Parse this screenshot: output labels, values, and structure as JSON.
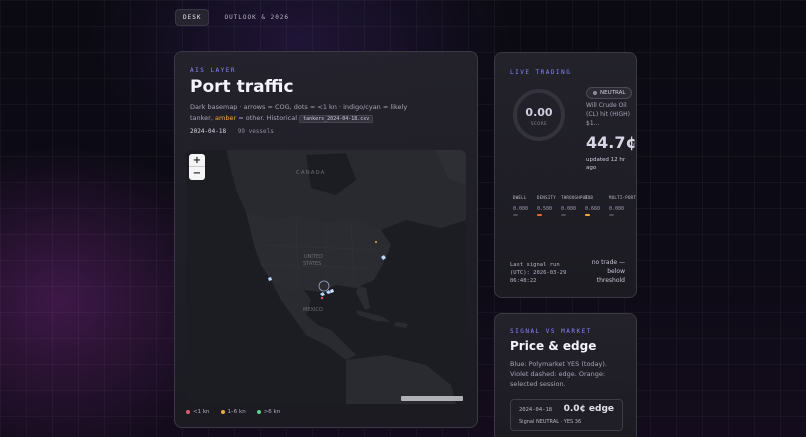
{
  "tabs": [
    {
      "label": "DESK",
      "active": true
    },
    {
      "label": "OUTLOOK & 2026",
      "active": false
    }
  ],
  "map_card": {
    "eyebrow": "AIS LAYER",
    "title": "Port traffic",
    "desc_prefix": "Dark basemap · arrows = COG, dots = <1 kn · indigo/cyan = likely tanker,",
    "desc_amber": "amber",
    "desc_suffix": "= other. Historical",
    "desc_file": "tankers_2024-04-18.csv",
    "date": "2024-04-18",
    "vessels": "99 vessels",
    "zoom_in": "+",
    "zoom_out": "−",
    "map_labels": {
      "canada": "CANADA",
      "us": "UNITED\nSTATES",
      "mexico": "MEXICO"
    },
    "legend": [
      {
        "label": "<1 kn",
        "color": "#e05a6a"
      },
      {
        "label": "1–6 kn",
        "color": "#f0a840"
      },
      {
        "label": ">6 kn",
        "color": "#5ad08a"
      }
    ]
  },
  "live_card": {
    "eyebrow": "LIVE TRADING",
    "score_value": "0.00",
    "score_label": "SCORE",
    "badge": "NEUTRAL",
    "market": "Will Crude Oil (CL) hit (HIGH) $1...",
    "price": "44.7¢",
    "price_suffix": "Y",
    "updated": "updated 12 hr ago",
    "metrics": [
      {
        "label": "DWELL",
        "value": "0.000",
        "bar_color": "#4a4954"
      },
      {
        "label": "DENSITY",
        "value": "0.500",
        "bar_color": "#e06a3a"
      },
      {
        "label": "THROUGHPUT",
        "value": "0.000",
        "bar_color": "#4a4954"
      },
      {
        "label": "BOB",
        "value": "0.660",
        "bar_color": "#f0a840"
      },
      {
        "label": "MULTI-PORT",
        "value": "0.000",
        "bar_color": "#4a4954"
      }
    ],
    "signal": "Last signal run (UTC): 2026-03-29 06:48:22",
    "no_trade": "no trade — below threshold"
  },
  "price_card": {
    "eyebrow": "SIGNAL VS MARKET",
    "title": "Price & edge",
    "desc": "Blue: Polymarket YES (today). Violet dashed: edge. Orange: selected session.",
    "date": "2024-04-18",
    "edge": "0.0¢ edge",
    "status": "Signal NEUTRAL · YES 36"
  }
}
